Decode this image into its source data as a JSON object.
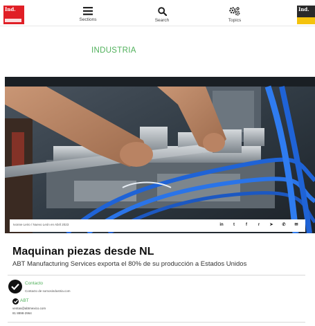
{
  "header": {
    "logo_left_text": "Ind.",
    "logo_right_text": "Ind.",
    "nav": [
      {
        "label": "Sections",
        "icon": "hamburger-icon"
      },
      {
        "label": "Search",
        "icon": "search-icon"
      },
      {
        "label": "Topics",
        "icon": "gears-icon"
      }
    ]
  },
  "article": {
    "category": "INDUSTRIA",
    "credit": "Ivonne Leiro / Nuevo León en Abril 2023",
    "share_icons": [
      "linkedin-icon",
      "twitter-icon",
      "facebook-icon",
      "reddit-icon",
      "telegram-icon",
      "whatsapp-icon",
      "email-icon"
    ],
    "share_glyphs": [
      "in",
      "t",
      "f",
      "r",
      "➤",
      "✆",
      "✉"
    ],
    "title": "Maquinan piezas desde NL",
    "subtitle": "ABT Manufacturing Services exporta el 80% de su producción a Estados Unidos"
  },
  "contact": {
    "label": "Contacto",
    "email": "Contacto de somosindustria.com"
  },
  "company": {
    "label": "ABT",
    "email": "ventas@abtmexico.com",
    "phone": "81 8898-2964"
  },
  "colors": {
    "accent_green": "#4fb05a",
    "logo_red": "#e01f26",
    "logo_yellow": "#f4c20d"
  }
}
